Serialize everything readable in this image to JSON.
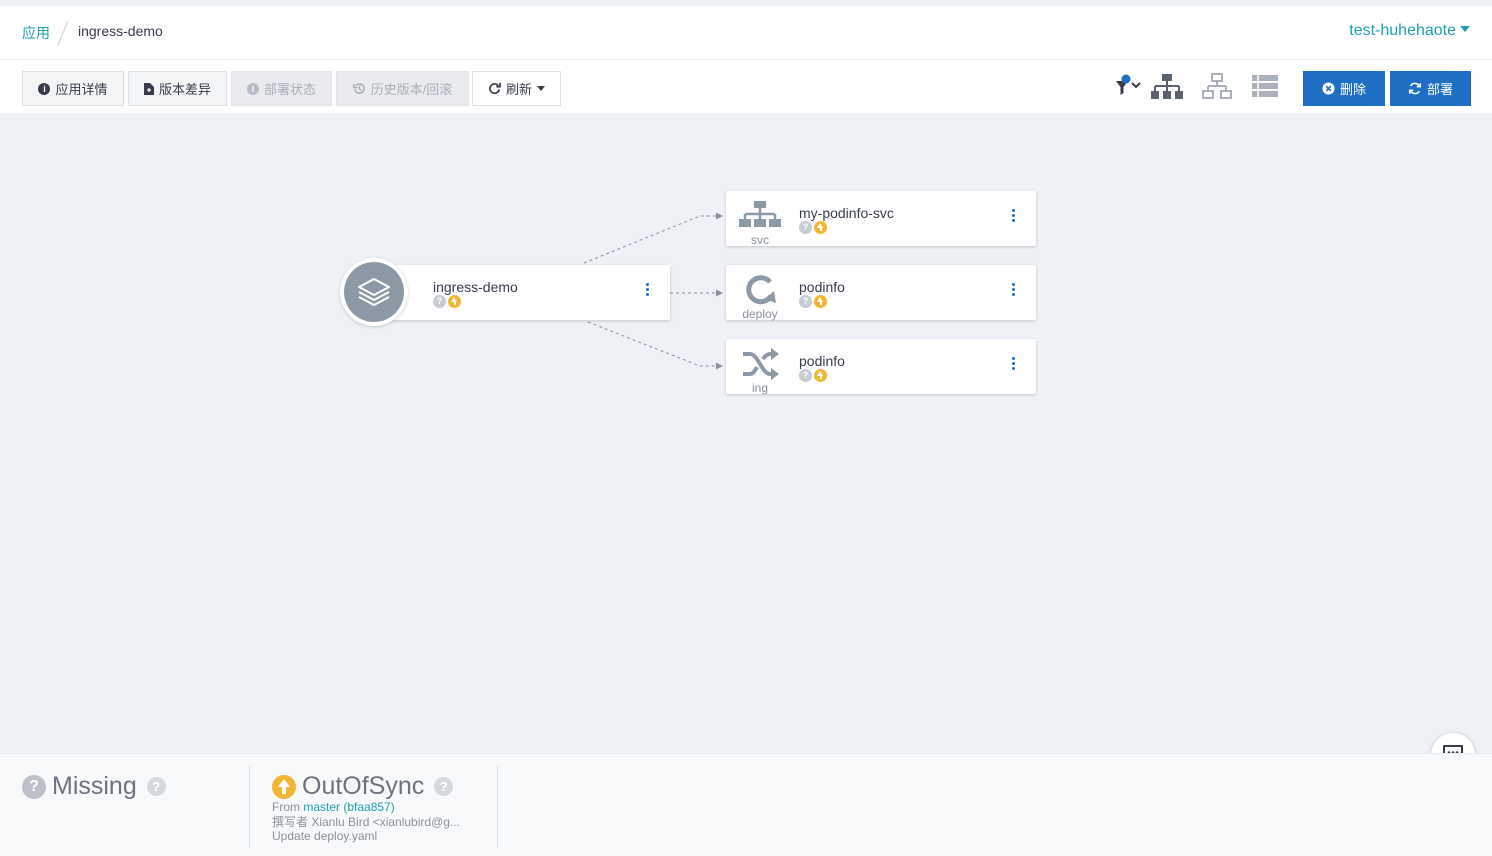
{
  "breadcrumb": {
    "root": "应用",
    "current": "ingress-demo"
  },
  "header": {
    "user": "test-huhehaote"
  },
  "toolbar": {
    "details": "应用详情",
    "diff": "版本差异",
    "sync_status": "部署状态",
    "history": "历史版本/回滚",
    "refresh": "刷新",
    "delete": "删除",
    "sync": "部署"
  },
  "colors": {
    "accent": "#1ea0ad",
    "primary": "#1e6fc4",
    "outofsync": "#f2b632",
    "missing": "#bcc1c9"
  },
  "tree": {
    "app": {
      "name": "ingress-demo",
      "icon": "layers-icon"
    },
    "resources": [
      {
        "name": "my-podinfo-svc",
        "kind": "svc",
        "icon": "sitemap-icon"
      },
      {
        "name": "podinfo",
        "kind": "deploy",
        "icon": "refresh-icon"
      },
      {
        "name": "podinfo",
        "kind": "ing",
        "icon": "shuffle-icon"
      }
    ]
  },
  "footer": {
    "health": "Missing",
    "sync": "OutOfSync",
    "from_label": "From",
    "revision": "master (bfaa857)",
    "author": "撰写者 Xianlu Bird <xianlubird@g...",
    "message": "Update deploy.yaml"
  }
}
